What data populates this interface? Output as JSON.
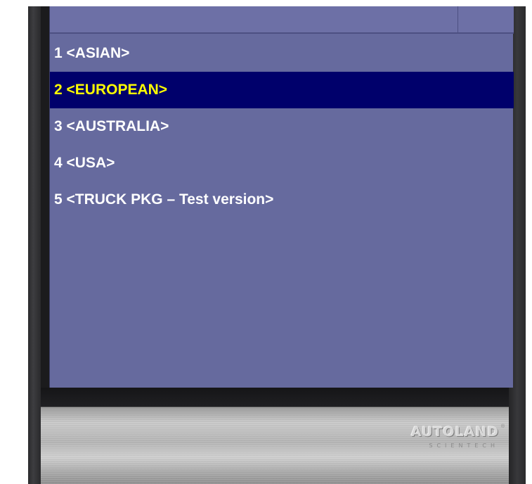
{
  "menu": {
    "items": [
      {
        "label": "1 <ASIAN>",
        "selected": false
      },
      {
        "label": "2 <EUROPEAN>",
        "selected": true
      },
      {
        "label": "3 <AUSTRALIA>",
        "selected": false
      },
      {
        "label": "4 <USA>",
        "selected": false
      },
      {
        "label": "5 <TRUCK PKG – Test version>",
        "selected": false
      }
    ]
  },
  "brand": {
    "logo_text": "AUTOLAND",
    "logo_subtext": "SCIENTECH",
    "logo_mark": "®"
  },
  "colors": {
    "screen_background": "#666a9e",
    "selection_background": "#00006b",
    "selection_text": "#ffff00",
    "item_text": "#ffffff"
  }
}
